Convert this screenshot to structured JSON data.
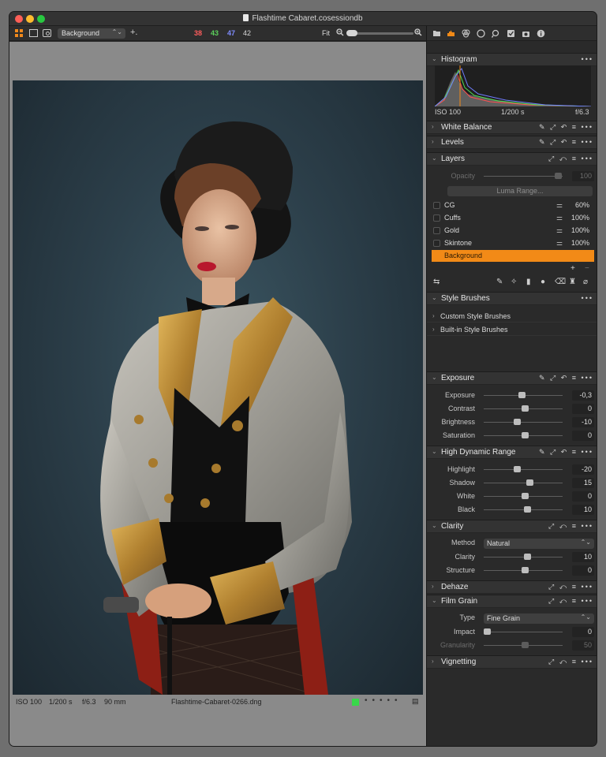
{
  "window": {
    "title": "Flashtime Cabaret.cosessiondb"
  },
  "toolbar": {
    "layer_select": "Background",
    "rgb": {
      "r": "38",
      "g": "43",
      "b": "47",
      "l": "42"
    },
    "fit_label": "Fit"
  },
  "photo": {
    "status": {
      "iso": "ISO 100",
      "shutter": "1/200 s",
      "aperture": "f/6.3",
      "focal": "90 mm",
      "filename": "Flashtime-Cabaret-0266.dng"
    }
  },
  "colors": {
    "accent": "#f28a17",
    "panel": "#2a2a2a",
    "green_tag": "#39d84a"
  },
  "histogram": {
    "title": "Histogram",
    "iso": "ISO 100",
    "shutter": "1/200 s",
    "aperture": "f/6.3"
  },
  "white_balance": {
    "title": "White Balance"
  },
  "levels": {
    "title": "Levels"
  },
  "layers": {
    "title": "Layers",
    "opacity_label": "Opacity",
    "opacity_value": "100",
    "luma_range": "Luma Range...",
    "items": [
      {
        "name": "CG",
        "pct": "60%"
      },
      {
        "name": "Cuffs",
        "pct": "100%"
      },
      {
        "name": "Gold",
        "pct": "100%"
      },
      {
        "name": "Skintone",
        "pct": "100%"
      },
      {
        "name": "Background",
        "pct": ""
      }
    ]
  },
  "style_brushes": {
    "title": "Style Brushes",
    "items": [
      "Custom Style Brushes",
      "Built-in Style Brushes"
    ]
  },
  "exposure": {
    "title": "Exposure",
    "rows": [
      {
        "label": "Exposure",
        "value": "-0,3",
        "pos": 0.46
      },
      {
        "label": "Contrast",
        "value": "0",
        "pos": 0.5
      },
      {
        "label": "Brightness",
        "value": "-10",
        "pos": 0.4
      },
      {
        "label": "Saturation",
        "value": "0",
        "pos": 0.5
      }
    ]
  },
  "hdr": {
    "title": "High Dynamic Range",
    "rows": [
      {
        "label": "Highlight",
        "value": "-20",
        "pos": 0.4
      },
      {
        "label": "Shadow",
        "value": "15",
        "pos": 0.57
      },
      {
        "label": "White",
        "value": "0",
        "pos": 0.5
      },
      {
        "label": "Black",
        "value": "10",
        "pos": 0.54
      }
    ]
  },
  "clarity": {
    "title": "Clarity",
    "method_label": "Method",
    "method_value": "Natural",
    "rows": [
      {
        "label": "Clarity",
        "value": "10",
        "pos": 0.54
      },
      {
        "label": "Structure",
        "value": "0",
        "pos": 0.5
      }
    ]
  },
  "dehaze": {
    "title": "Dehaze"
  },
  "film_grain": {
    "title": "Film Grain",
    "type_label": "Type",
    "type_value": "Fine Grain",
    "rows": [
      {
        "label": "Impact",
        "value": "0",
        "pos": 0.0
      },
      {
        "label": "Granularity",
        "value": "50",
        "pos": 0.5
      }
    ]
  },
  "vignetting": {
    "title": "Vignetting"
  },
  "icons": {
    "toolbar": [
      "grid-icon",
      "single-view-icon",
      "eye-view-icon",
      "crosshair-icon",
      "zoom-out-icon",
      "zoom-in-icon"
    ],
    "tabs": [
      "folder-icon",
      "capture-icon",
      "color-icon",
      "lens-icon",
      "search-icon",
      "checklist-icon",
      "camera-icon",
      "info-icon"
    ],
    "panel_actions": [
      "picker-icon",
      "copy-icon",
      "reset-icon",
      "presets-icon",
      "more-icon"
    ]
  }
}
